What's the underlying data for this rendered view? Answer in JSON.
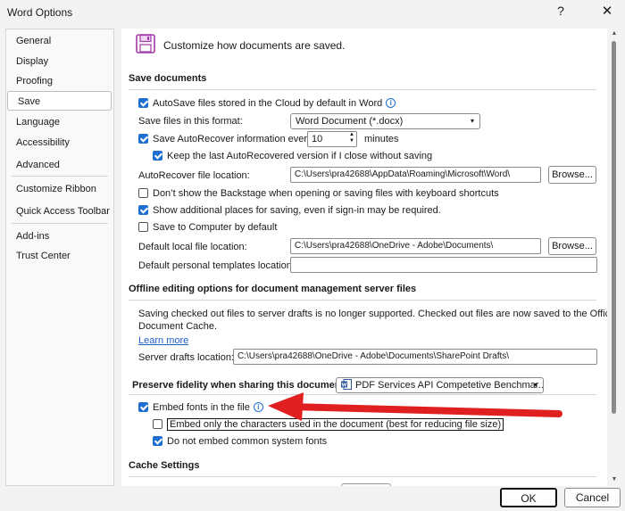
{
  "window": {
    "title": "Word Options",
    "help": "?",
    "close": "✕"
  },
  "nav": [
    {
      "label": "General"
    },
    {
      "label": "Display"
    },
    {
      "label": "Proofing"
    },
    {
      "label": "Save",
      "active": true
    },
    {
      "label": "Language"
    },
    {
      "label": "Accessibility"
    },
    {
      "label": "Advanced"
    },
    {
      "label": "Customize Ribbon"
    },
    {
      "label": "Quick Access Toolbar"
    },
    {
      "label": "Add-ins"
    },
    {
      "label": "Trust Center"
    }
  ],
  "header": {
    "text": "Customize how documents are saved."
  },
  "save_documents": {
    "title": "Save documents",
    "autosave_label": "AutoSave files stored in the Cloud by default in Word",
    "format_label": "Save files in this format:",
    "format_value": "Word Document (*.docx)",
    "autorecover_label": "Save AutoRecover information every",
    "autorecover_minutes": "10",
    "minutes_label": "minutes",
    "keep_last_label": "Keep the last AutoRecovered version if I close without saving",
    "autorecover_location_label": "AutoRecover file location:",
    "autorecover_location_value": "C:\\Users\\pra42688\\AppData\\Roaming\\Microsoft\\Word\\",
    "browse_label": "Browse...",
    "dont_show_backstage_label": "Don’t show the Backstage when opening or saving files with keyboard shortcuts",
    "show_additional_label": "Show additional places for saving, even if sign-in may be required.",
    "save_to_computer_label": "Save to Computer by default",
    "default_local_label": "Default local file location:",
    "default_local_value": "C:\\Users\\pra42688\\OneDrive - Adobe\\Documents\\",
    "default_templates_label": "Default personal templates location:",
    "default_templates_value": ""
  },
  "offline": {
    "title": "Offline editing options for document management server files",
    "note_line1": "Saving checked out files to server drafts is no longer supported. Checked out files are now saved to the Office",
    "note_line2": "Document Cache.",
    "learn_more": "Learn more",
    "drafts_label": "Server drafts location:",
    "drafts_value": "C:\\Users\\pra42688\\OneDrive - Adobe\\Documents\\SharePoint Drafts\\"
  },
  "fidelity": {
    "title": "Preserve fidelity when sharing this document:",
    "document_value": "PDF Services API Competetive Benchmar...",
    "embed_fonts_label": "Embed fonts in the file",
    "embed_only_label": "Embed only the characters used in the document (best for reducing file size)",
    "no_common_label": "Do not embed common system fonts"
  },
  "cache": {
    "title": "Cache Settings"
  },
  "footer": {
    "ok": "OK",
    "cancel": "Cancel"
  },
  "colors": {
    "accent": "#1f6fd1",
    "arrow": "#e02020",
    "save_icon": "#a03aa8"
  }
}
